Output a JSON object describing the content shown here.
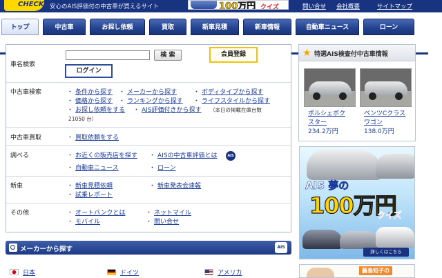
{
  "header": {
    "logo": "CHECK",
    "tagline": "安心のAIS評価付の中古車が買えるサイト",
    "banner_text": "100万円",
    "banner_sub": "クイズ",
    "links": [
      "問い合せ",
      "会社概要",
      "サイトマップ"
    ]
  },
  "nav": {
    "tabs": [
      "トップ",
      "中古車",
      "お探し依頼",
      "買取",
      "新車見積",
      "新車情報",
      "自動車ニュース",
      "ローン"
    ]
  },
  "search": {
    "maker_label": "車名検索",
    "maker_input_value": "",
    "search_button": "検 索",
    "register_button": "会員登録",
    "login_button": "ログイン",
    "used": {
      "label": "中古車検索",
      "items": [
        "条件から探す",
        "メーカーから探す",
        "ボディタイプから探す",
        "価格から探す",
        "ランキングから探す",
        "ライフスタイルから探す",
        "お探し依頼をする",
        "AIS評価付きから探す"
      ],
      "note": "（本日の掲載在庫台数",
      "count": "21050 台）"
    },
    "buy": {
      "label": "中古車買取",
      "items": [
        "買取依頼をする"
      ]
    },
    "research": {
      "label": "調べる",
      "items": [
        "お近くの販売店を探す",
        "AISの中古車評価とは",
        "自動車ニュース",
        "ローン"
      ],
      "badge": "AIS"
    },
    "newcar": {
      "label": "新車",
      "items": [
        "新車見積依頼",
        "新車発表会速報",
        "試乗レポート"
      ]
    },
    "other": {
      "label": "その他",
      "items": [
        "オートバンクとは",
        "ネットマイル",
        "モバイル",
        "問い合せ"
      ]
    }
  },
  "maker_section": {
    "title": "メーカーから探す",
    "badge": "AIS",
    "countries": [
      "日本",
      "ドイツ",
      "アメリカ"
    ]
  },
  "featured": {
    "title": "特選AIS検査付中古車情報",
    "cars": [
      {
        "name_line1": "ポルシェボク",
        "name_line2": "スター",
        "price": "234.2万円"
      },
      {
        "name_line1": "ベンツCクラス",
        "name_line2": "ワゴン",
        "price": "138.0万円"
      }
    ]
  },
  "ad": {
    "line1": "AIS 夢の",
    "line2": "100万円",
    "line3": "クイズ",
    "more": "詳しくはこちら"
  },
  "ad2": {
    "name": "藤島知子の"
  }
}
